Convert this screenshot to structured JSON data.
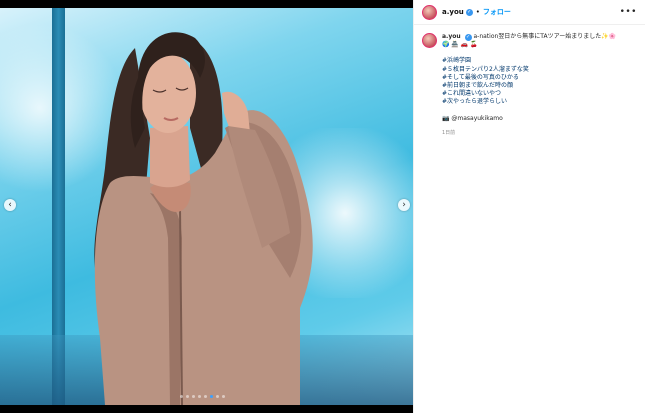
{
  "post": {
    "username": "a.you",
    "follow_label": "フォロー",
    "more_icon": "•••",
    "caption_first_line": "a-nation翌日から無事にTAツアー始まりました✨🌸",
    "caption_emojis": "🌍 🏯 🚗 🍒",
    "hashtags": [
      "#浜崎学園",
      "#５枚目テンパり2人溜まずな笑",
      "#そして最後の写真のひかる",
      "#前日朝まで飲んだ時の顔",
      "#これ間違いないやつ",
      "#次やったら退学らしい"
    ],
    "photo_credit": "📷 @masayukikamo",
    "timestamp": "1日前"
  },
  "carousel": {
    "prev_icon": "‹",
    "next_icon": "›",
    "slide_count": 8,
    "active_index": 5
  }
}
